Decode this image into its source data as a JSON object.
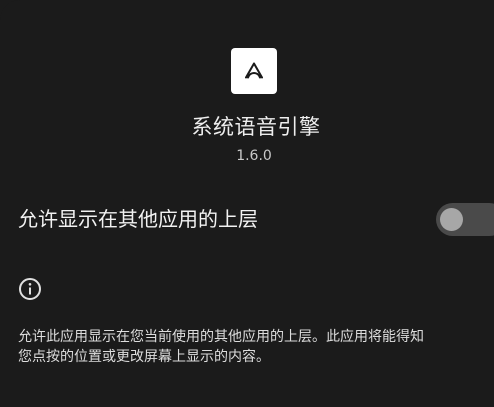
{
  "app": {
    "icon": "app-logo-icon",
    "name": "系统语音引擎",
    "version": "1.6.0"
  },
  "setting": {
    "label": "允许显示在其他应用的上层",
    "toggle_on": false
  },
  "info": {
    "icon": "info-icon",
    "lines": [
      "允许此应用显示在您当前使用的其他应用的上层。此应用将能得知",
      "您点按的位置或更改屏幕上显示的内容。"
    ]
  },
  "colors": {
    "background": "#1b1b1b",
    "toggle_track": "#4a4a4a",
    "toggle_thumb": "#a7a7a7",
    "icon_tile": "#ffffff"
  }
}
